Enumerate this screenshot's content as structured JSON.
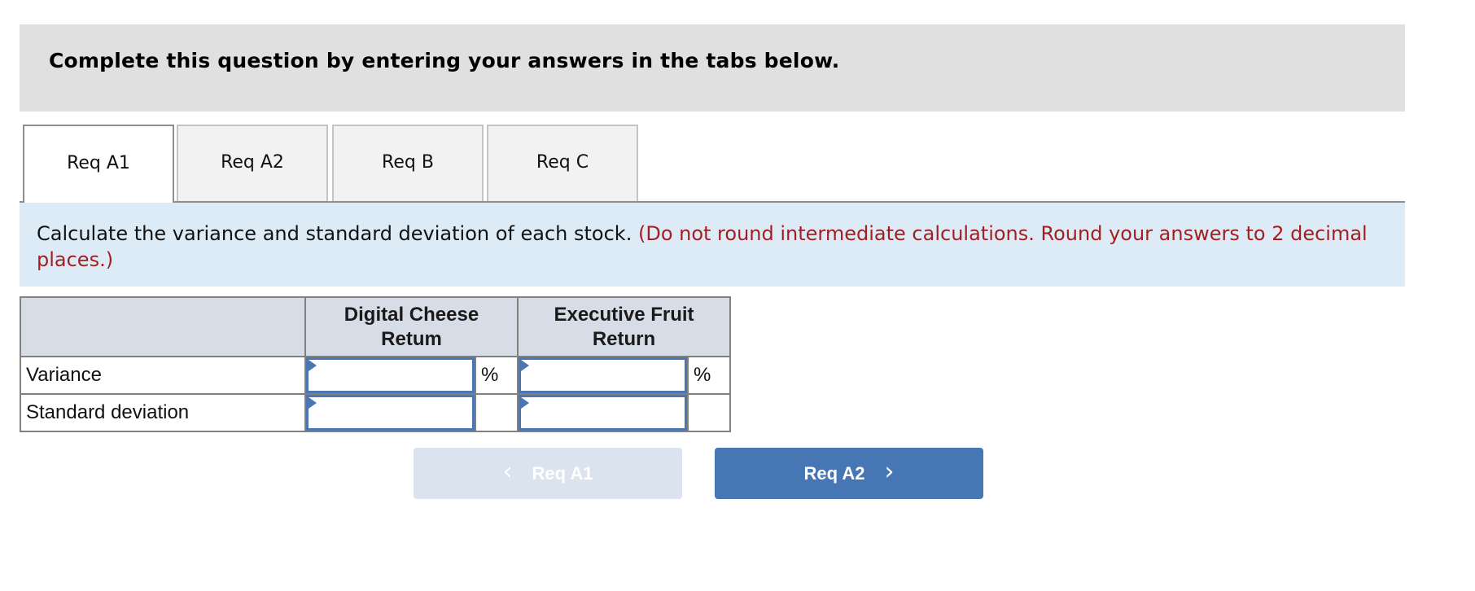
{
  "header": {
    "title": "Complete this question by entering your answers in the tabs below."
  },
  "tabs": [
    {
      "label": "Req A1",
      "active": true
    },
    {
      "label": "Req A2",
      "active": false
    },
    {
      "label": "Req B",
      "active": false
    },
    {
      "label": "Req C",
      "active": false
    }
  ],
  "instructions": {
    "text": "Calculate the variance and standard deviation of each stock.",
    "note": "(Do not round intermediate calculations. Round your answers to 2 decimal places.)"
  },
  "table": {
    "columns": [
      "",
      "Digital Cheese Retum",
      "Executive Fruit Return"
    ],
    "rows": [
      {
        "label": "Variance",
        "digital_cheese": "",
        "executive_fruit": "",
        "unit": "%"
      },
      {
        "label": "Standard deviation",
        "digital_cheese": "",
        "executive_fruit": "",
        "unit": ""
      }
    ]
  },
  "navigation": {
    "prev_label": "Req A1",
    "prev_icon": "chevron-left-icon",
    "prev_enabled": false,
    "next_label": "Req A2",
    "next_icon": "chevron-right-icon",
    "next_enabled": true
  },
  "colors": {
    "header_bg": "#e0e0e0",
    "instructions_bg": "#ddebf7",
    "note_red": "#a31f1f",
    "table_header_bg": "#d7dde6",
    "input_border": "#4a76b4",
    "button_primary": "#4676b4",
    "button_disabled": "#dae3ee"
  }
}
